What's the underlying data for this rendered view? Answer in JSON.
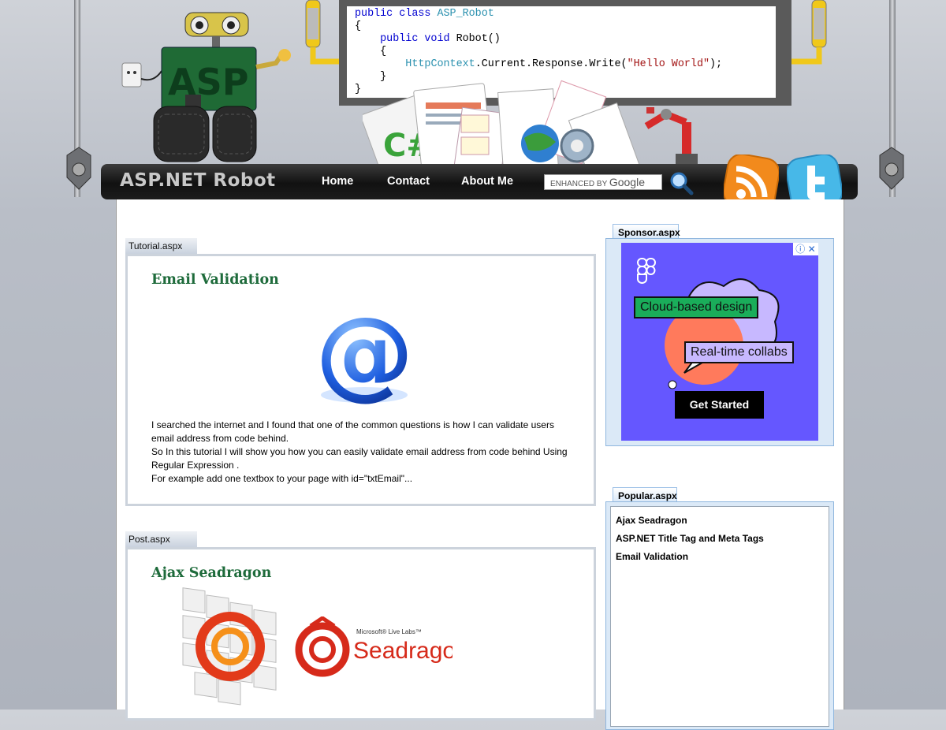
{
  "header": {
    "code_lines": [
      {
        "parts": [
          {
            "t": "public class ",
            "c": "kw"
          },
          {
            "t": "ASP_Robot",
            "c": "ty"
          }
        ]
      },
      {
        "parts": [
          {
            "t": "{",
            "c": ""
          }
        ]
      },
      {
        "parts": [
          {
            "t": "    public void ",
            "c": "kw"
          },
          {
            "t": "Robot()",
            "c": ""
          }
        ]
      },
      {
        "parts": [
          {
            "t": "    {",
            "c": ""
          }
        ]
      },
      {
        "parts": [
          {
            "t": "        ",
            "c": ""
          },
          {
            "t": "HttpContext",
            "c": "ty"
          },
          {
            "t": ".Current.Response.Write(",
            "c": ""
          },
          {
            "t": "\"Hello World\"",
            "c": "st"
          },
          {
            "t": ");",
            "c": ""
          }
        ]
      },
      {
        "parts": [
          {
            "t": "    }",
            "c": ""
          }
        ]
      },
      {
        "parts": [
          {
            "t": "}",
            "c": ""
          }
        ]
      }
    ]
  },
  "nav": {
    "brand": "ASP.NET Robot",
    "links": [
      "Home",
      "Contact",
      "About Me"
    ],
    "search_placeholder_small": "ENHANCED BY",
    "search_placeholder_google": "Google"
  },
  "posts": [
    {
      "tab": "Tutorial.aspx",
      "title": "Email Validation",
      "excerpt": [
        "I searched the internet and I found that one of the common questions is how I can validate users email address from code behind.",
        "So In this tutorial I will show you how you can easily validate email address from code behind Using Regular Expression .",
        "For example add one textbox to your page with id=\"txtEmail\"..."
      ]
    },
    {
      "tab": "Post.aspx",
      "title": "Ajax Seadragon",
      "logo_small": "Microsoft® Live Labs™",
      "logo_big": "Seadragon"
    }
  ],
  "sidebar": {
    "sponsor_tab": "Sponsor.aspx",
    "ad": {
      "pill1": "Cloud-based design",
      "pill2": "Real-time collabs",
      "cta": "Get Started",
      "info": "ⓘ",
      "close": "✕"
    },
    "popular_tab": "Popular.aspx",
    "popular_links": [
      "Ajax Seadragon",
      "ASP.NET Title Tag and Meta Tags",
      "Email Validation"
    ]
  },
  "colors": {
    "title_green": "#1e6b3b",
    "ad_purple": "#6557ff",
    "rss_orange": "#f28a1c",
    "twitter_blue": "#47b8e8"
  }
}
